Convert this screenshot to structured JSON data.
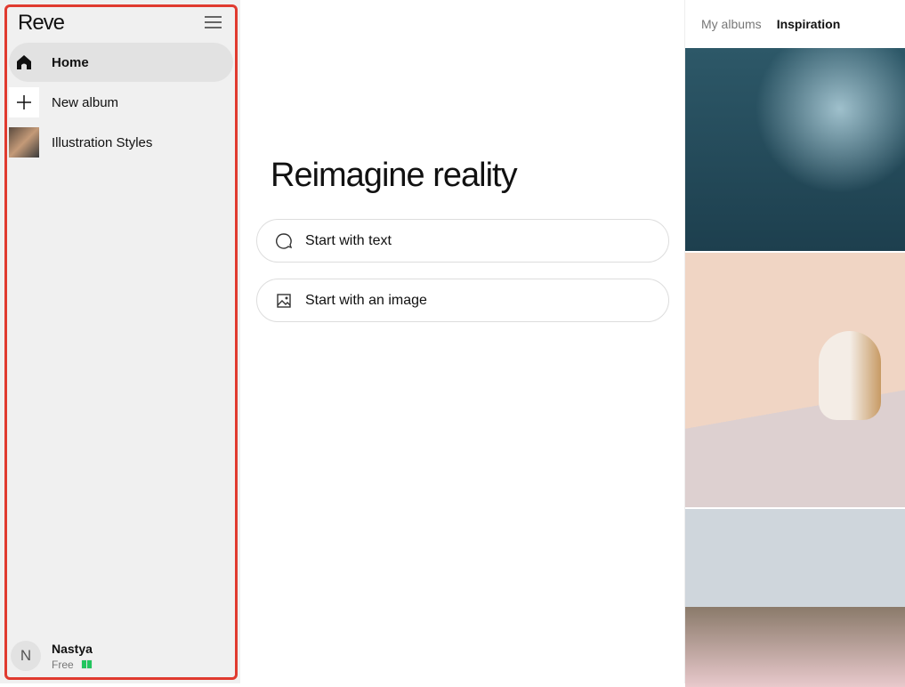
{
  "sidebar": {
    "logo": "Reve",
    "items": [
      {
        "label": "Home"
      },
      {
        "label": "New album"
      },
      {
        "label": "Illustration Styles"
      }
    ],
    "user": {
      "initial": "N",
      "name": "Nastya",
      "plan": "Free"
    }
  },
  "main": {
    "title": "Reimagine reality",
    "start_text": "Start with text",
    "start_image": "Start with an image"
  },
  "right": {
    "tabs": [
      "My albums",
      "Inspiration"
    ]
  }
}
